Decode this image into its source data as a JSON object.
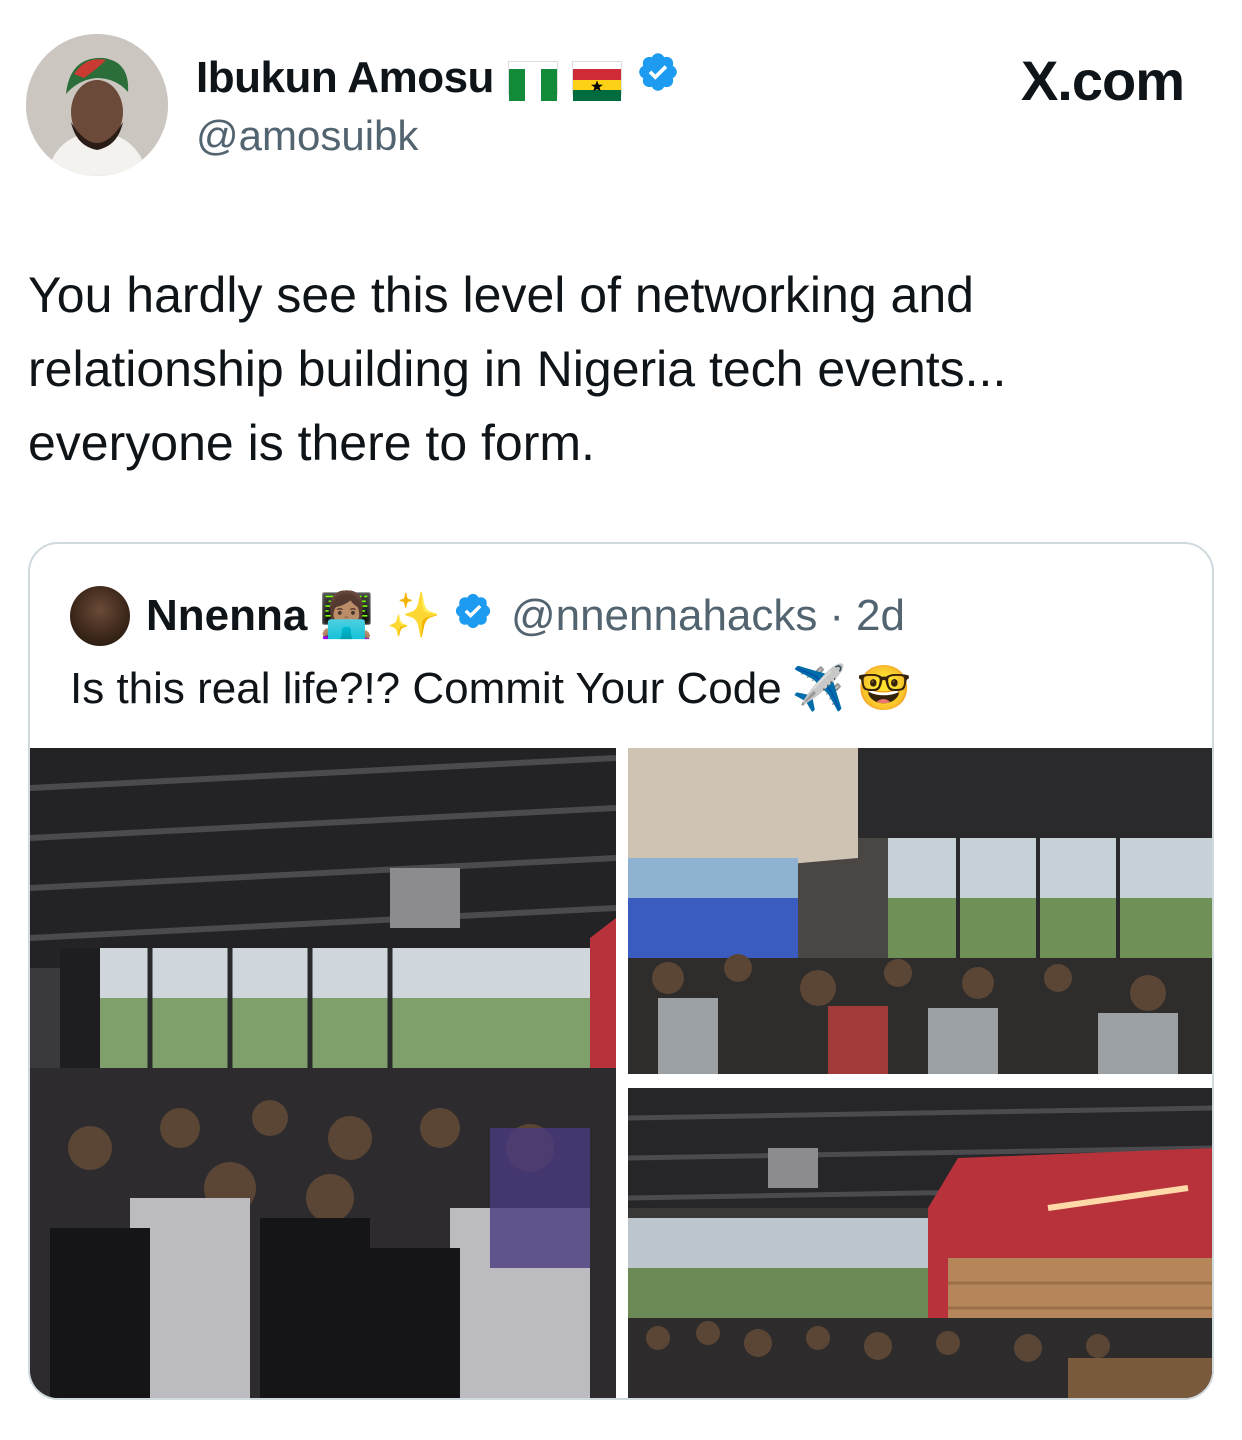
{
  "tweet": {
    "author_name": "Ibukun Amosu",
    "author_flags": [
      "nigeria-flag",
      "ghana-flag"
    ],
    "author_handle": "@amosuibk",
    "verified": true,
    "text_lines": [
      "You hardly see this level of networking and",
      "relationship building in Nigeria tech events...",
      "everyone is there to form."
    ]
  },
  "brand": "X.com",
  "quoted_tweet": {
    "author_name": "Nnenna",
    "name_emojis": [
      "woman-technologist-emoji",
      "sparkles-emoji"
    ],
    "author_handle": "@nnennahacks",
    "separator": "·",
    "time": "2d",
    "verified": true,
    "text": "Is this real life?!? Commit Your Code",
    "text_emojis": [
      "airplane-emoji",
      "nerd-face-emoji"
    ],
    "photos": [
      "networking-event-photo-1",
      "networking-event-photo-2",
      "networking-event-photo-3"
    ]
  },
  "colors": {
    "verified_blue": "#1d9bf0",
    "secondary_text": "#536471",
    "border": "#cfd9de",
    "venue_red": "#b8323b"
  }
}
